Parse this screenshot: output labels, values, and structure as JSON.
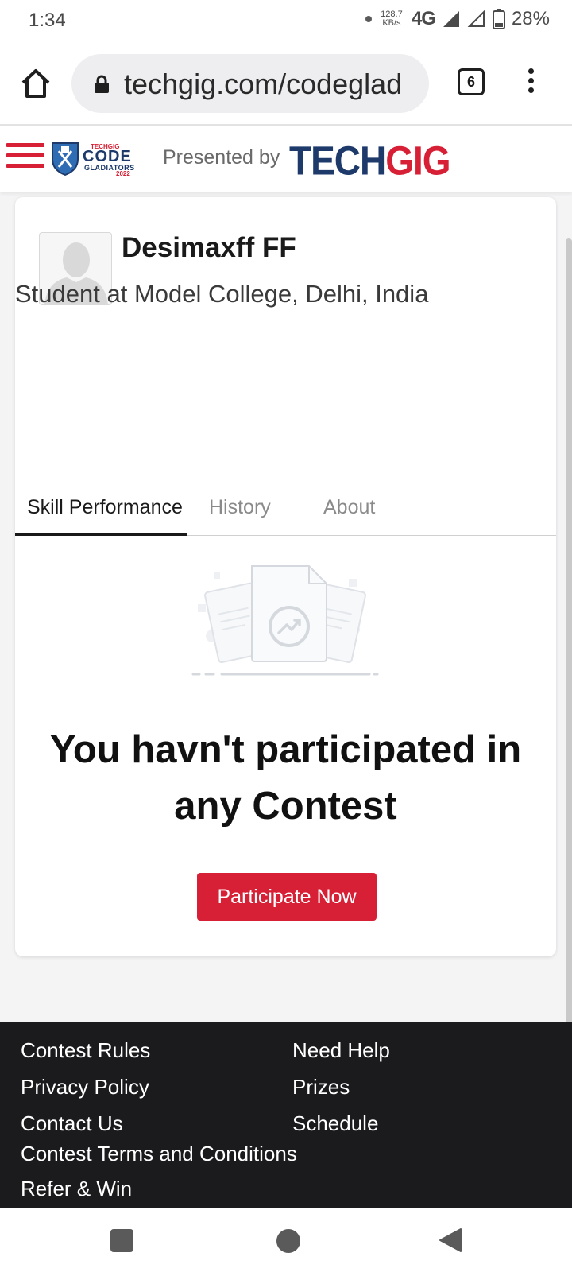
{
  "status_bar": {
    "time": "1:34",
    "speed_value": "128.7",
    "speed_unit": "KB/s",
    "network": "4G",
    "battery": "28%"
  },
  "browser": {
    "url": "techgig.com/codeglad",
    "tab_count": "6"
  },
  "site_header": {
    "logo_small": "TECHGIG",
    "logo_code": "CODE",
    "logo_gladiators": "GLADIATORS",
    "logo_year": "2022",
    "presented_by": "Presented by",
    "brand_part1": "TECH",
    "brand_part2": "GIG"
  },
  "profile": {
    "name": "Desimaxff FF",
    "role": "Student at Model College, Delhi, India"
  },
  "tabs": [
    {
      "label": "Skill Performance",
      "active": true
    },
    {
      "label": "History",
      "active": false
    },
    {
      "label": "About",
      "active": false
    }
  ],
  "empty_state": {
    "message": "You havn't participated in any Contest",
    "button_label": "Participate Now"
  },
  "footer": {
    "links_left": [
      "Contest Rules",
      "Privacy Policy",
      "Contact Us",
      "Contest Terms and Conditions",
      "Refer & Win"
    ],
    "links_right": [
      "Need Help",
      "Prizes",
      "Schedule"
    ]
  },
  "colors": {
    "brand_red": "#d72035",
    "brand_navy": "#1d3a6b",
    "footer_bg": "#1b1a1d"
  }
}
